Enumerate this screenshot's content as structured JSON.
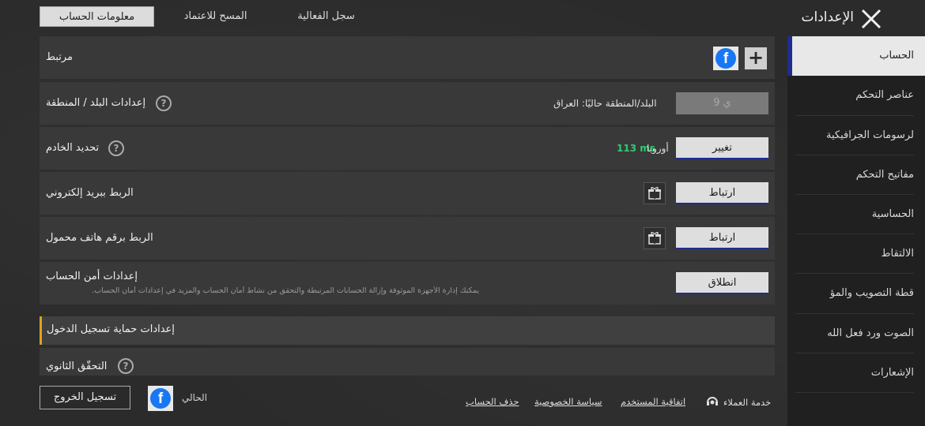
{
  "header": {
    "title": "الإعدادات"
  },
  "sidebar": {
    "items": [
      {
        "label": "الحساب"
      },
      {
        "label": "عناصر التحكم"
      },
      {
        "label": "لرسومات الجرافيكية"
      },
      {
        "label": "مفاتيح التحكم"
      },
      {
        "label": "الحساسية"
      },
      {
        "label": "الالتقاط"
      },
      {
        "label": "قطة التصويب والمؤ"
      },
      {
        "label": "الصوت ورد فعل الله"
      },
      {
        "label": "الإشعارات"
      }
    ]
  },
  "tabs": [
    {
      "label": "معلومات الحساب"
    },
    {
      "label": "المسح للاعتماد"
    },
    {
      "label": "سجل الفعالية"
    }
  ],
  "rows": {
    "linked": {
      "label": "مرتبط"
    },
    "region": {
      "label": "إعدادات البلد / المنطقة",
      "current": "البلد/المنطقة حاليًا: العراق",
      "button": "9 ي"
    },
    "server": {
      "label": "تحديد الخادم",
      "server_name": "أوروبا",
      "ping": "113 ms",
      "button": "تغيير"
    },
    "email": {
      "label": "الربط ببريد إلكتروني",
      "button": "ارتباط"
    },
    "phone": {
      "label": "الربط برقم هاتف محمول",
      "button": "ارتباط"
    },
    "security": {
      "label": "إعدادات أمن الحساب",
      "description_line1": "يمكنك إدارة الأجهزة الموثوقة وإزالة الحسابات المرتبطة والتحقق من نشاط أمان الحساب والمزيد في إعدادات أمان الحساب.",
      "button": "انطلاق"
    },
    "login_protection": {
      "label": "إعدادات حماية تسجيل الدخول"
    },
    "two_step": {
      "label": "التحقّق الثانوي"
    }
  },
  "footer": {
    "logout": "تسجيل الخروج",
    "current_label": "الحالي",
    "support": "خدمة العملاء",
    "user_agreement": "اتفاقية المستخدم",
    "privacy": "سياسة الخصوصية",
    "delete_account": "حذف الحساب"
  },
  "colors": {
    "accent": "#1f2d8f",
    "facebook": "#1877f2",
    "ping": "#2ecc71"
  }
}
